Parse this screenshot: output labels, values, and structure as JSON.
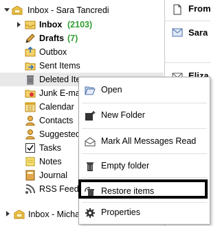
{
  "folders": {
    "account1": {
      "label": "Inbox - Sara Tancredi"
    },
    "inbox": {
      "label": "Inbox",
      "count": "(2103)"
    },
    "drafts": {
      "label": "Drafts",
      "count": "(7)"
    },
    "outbox": {
      "label": "Outbox"
    },
    "sent": {
      "label": "Sent Items"
    },
    "deleted": {
      "label": "Deleted Items"
    },
    "junk": {
      "label": "Junk E-mail"
    },
    "calendar": {
      "label": "Calendar"
    },
    "contacts": {
      "label": "Contacts"
    },
    "suggested": {
      "label": "Suggested Contacts"
    },
    "tasks": {
      "label": "Tasks"
    },
    "notes": {
      "label": "Notes"
    },
    "journal": {
      "label": "Journal"
    },
    "rss": {
      "label": "RSS Feeds"
    },
    "account2": {
      "label": "Inbox - Michael"
    }
  },
  "reading_pane": {
    "from_label": "From",
    "sender1": "Sara",
    "sender2": "Eliza"
  },
  "context_menu": {
    "items": [
      {
        "label": "Open",
        "icon": "open-folder-icon"
      },
      {
        "label": "New Folder",
        "icon": "new-folder-icon"
      },
      {
        "label": "Mark All Messages Read",
        "icon": "envelope-open-icon"
      },
      {
        "label": "Empty folder",
        "icon": "trash-icon"
      },
      {
        "label": "Restore items",
        "icon": "restore-icon"
      },
      {
        "label": "Properties",
        "icon": "gear-icon"
      }
    ],
    "highlighted_item": "Restore items"
  },
  "colors": {
    "count_green": "#2e9e2e",
    "highlight_border": "#000000",
    "menu_border": "#a8a8a8"
  }
}
